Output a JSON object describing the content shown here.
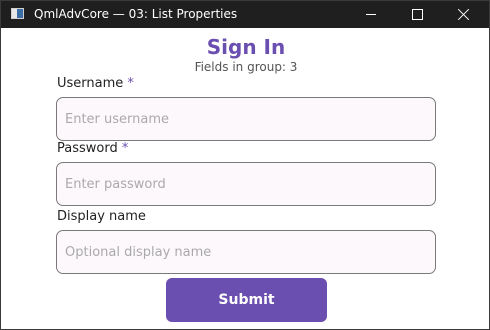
{
  "window": {
    "title": "QmlAdvCore — 03: List Properties"
  },
  "form": {
    "heading": "Sign In",
    "subheading": "Fields in group: 3",
    "required_marker": "*",
    "fields": [
      {
        "label": "Username",
        "required": true,
        "placeholder": "Enter username",
        "value": ""
      },
      {
        "label": "Password",
        "required": true,
        "placeholder": "Enter password",
        "value": ""
      },
      {
        "label": "Display name",
        "required": false,
        "placeholder": "Optional display name",
        "value": ""
      }
    ],
    "submit_label": "Submit"
  },
  "colors": {
    "accent": "#6b4fb0",
    "titlebar": "#1f1f1f",
    "input_background": "#fdf8fc"
  },
  "icons": {
    "app": "app-window-icon",
    "minimize": "minimize-icon",
    "maximize": "maximize-icon",
    "close": "close-icon"
  }
}
